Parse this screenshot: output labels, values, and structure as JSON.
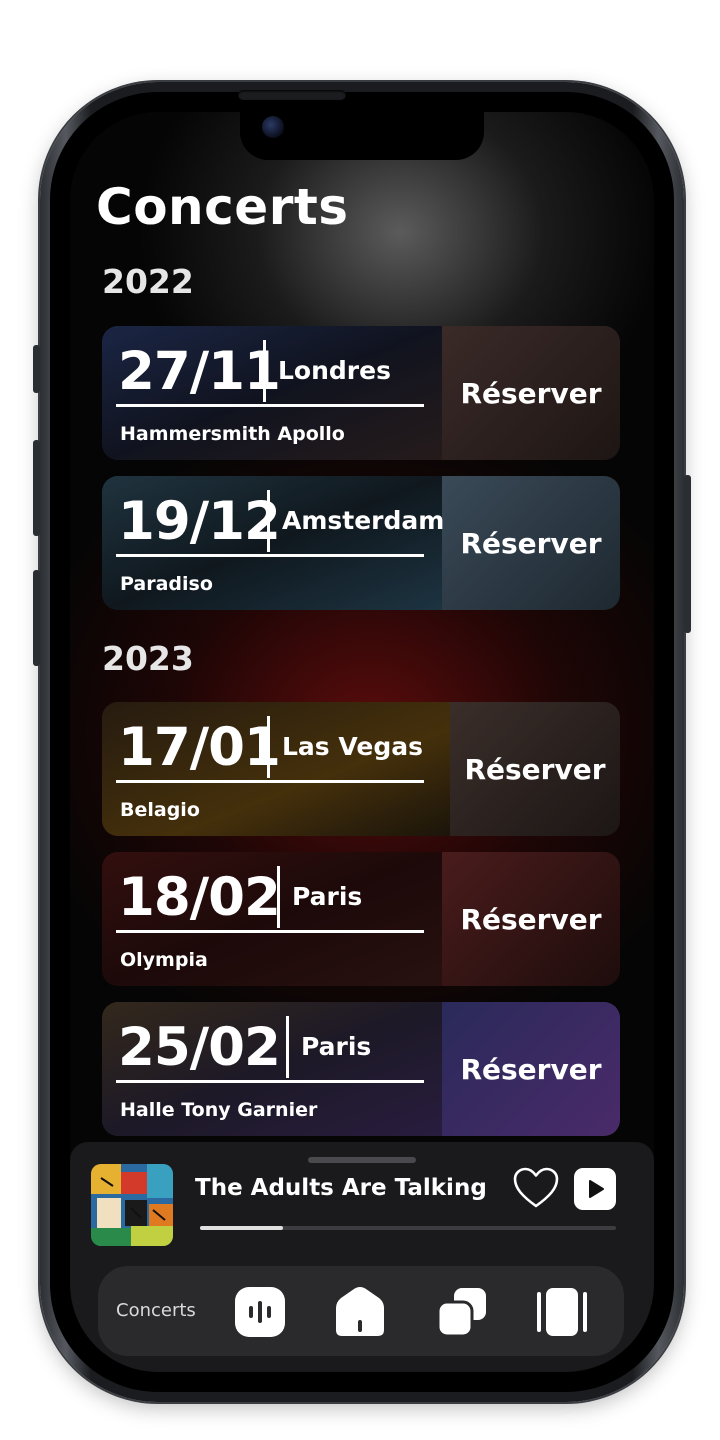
{
  "page": {
    "title": "Concerts"
  },
  "sections": [
    {
      "year": "2022",
      "concerts": [
        {
          "date": "27/11",
          "city": "Londres",
          "venue": "Hammersmith Apollo",
          "action": "Réserver"
        },
        {
          "date": "19/12",
          "city": "Amsterdam",
          "venue": "Paradiso",
          "action": "Réserver"
        }
      ]
    },
    {
      "year": "2023",
      "concerts": [
        {
          "date": "17/01",
          "city": "Las Vegas",
          "venue": "Belagio",
          "action": "Réserver"
        },
        {
          "date": "18/02",
          "city": "Paris",
          "venue": "Olympia",
          "action": "Réserver"
        },
        {
          "date": "25/02",
          "city": "Paris",
          "venue": "Halle Tony Garnier",
          "action": "Réserver"
        }
      ]
    }
  ],
  "player": {
    "song_title": "The Adults Are Talking",
    "progress": 0.2,
    "icons": {
      "like": "heart-icon",
      "play": "play-icon"
    }
  },
  "nav": {
    "active_label": "Concerts",
    "items": [
      {
        "icon": "concerts-icon"
      },
      {
        "icon": "home-icon"
      },
      {
        "icon": "library-icon"
      },
      {
        "icon": "carousel-icon"
      }
    ]
  },
  "colors": {
    "background": "#050505",
    "accent_red": "#780e0e",
    "card_text": "#ffffff"
  }
}
